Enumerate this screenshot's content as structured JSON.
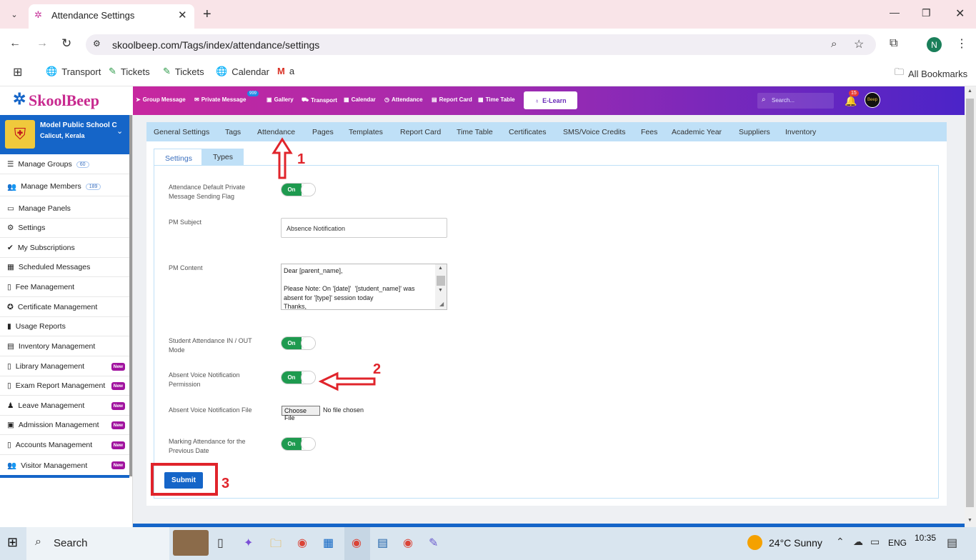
{
  "browser": {
    "tab_title": "Attendance Settings",
    "url": "skoolbeep.com/Tags/index/attendance/settings",
    "bookmarks": [
      "Transport",
      "Tickets",
      "Tickets",
      "Calendar",
      "a"
    ],
    "all_bookmarks": "All Bookmarks",
    "profile_initial": "N"
  },
  "app": {
    "logo": "SkoolBeep",
    "topnav": [
      "Group Message",
      "Private Message",
      "Gallery",
      "Transport",
      "Calendar",
      "Attendance",
      "Report Card",
      "Time Table"
    ],
    "private_message_badge": "999",
    "elearn": "E-Learn",
    "search_placeholder": "Search...",
    "notif_count": "15",
    "avatar_text": "Beep"
  },
  "school": {
    "name": "Model Public School C",
    "location": "Calicut, Kerala"
  },
  "sidebar": [
    {
      "label": "Manage Groups",
      "count": "60"
    },
    {
      "label": "Manage Members",
      "count": "189"
    },
    {
      "label": "Manage Panels"
    },
    {
      "label": "Settings"
    },
    {
      "label": "My Subscriptions"
    },
    {
      "label": "Scheduled Messages"
    },
    {
      "label": "Fee Management"
    },
    {
      "label": "Certificate Management"
    },
    {
      "label": "Usage Reports"
    },
    {
      "label": "Inventory Management"
    },
    {
      "label": "Library Management",
      "badge": "New"
    },
    {
      "label": "Exam Report Management",
      "badge": "New"
    },
    {
      "label": "Leave Management",
      "badge": "New"
    },
    {
      "label": "Admission Management",
      "badge": "New"
    },
    {
      "label": "Accounts Management",
      "badge": "New"
    },
    {
      "label": "Visitor Management",
      "badge": "New"
    }
  ],
  "subnav": [
    "General Settings",
    "Tags",
    "Attendance",
    "Pages",
    "Templates",
    "Report Card",
    "Time Table",
    "Certificates",
    "SMS/Voice Credits",
    "Fees",
    "Academic Year",
    "Suppliers",
    "Inventory"
  ],
  "tabs": [
    "Settings",
    "Types"
  ],
  "form": {
    "flag_label": "Attendance Default Private Message Sending Flag",
    "pm_subject_label": "PM Subject",
    "pm_subject_value": "Absence Notification",
    "pm_content_label": "PM Content",
    "pm_content_value": "Dear [parent_name],\n\nPlease Note: On '[date]'  '[student_name]' was absent for '[type]' session today\nThanks,",
    "inout_label": "Student Attendance IN / OUT Mode",
    "voice_perm_label": "Absent Voice Notification Permission",
    "voice_file_label": "Absent Voice Notification File",
    "choose_file": "Choose File",
    "no_file": "No file chosen",
    "prev_date_label": "Marking Attendance for the Previous Date",
    "toggle_on": "On",
    "submit": "Submit"
  },
  "annotations": [
    "1",
    "2",
    "3"
  ],
  "taskbar": {
    "search": "Search",
    "weather": "24°C  Sunny",
    "lang": "ENG",
    "time": "10:35"
  }
}
